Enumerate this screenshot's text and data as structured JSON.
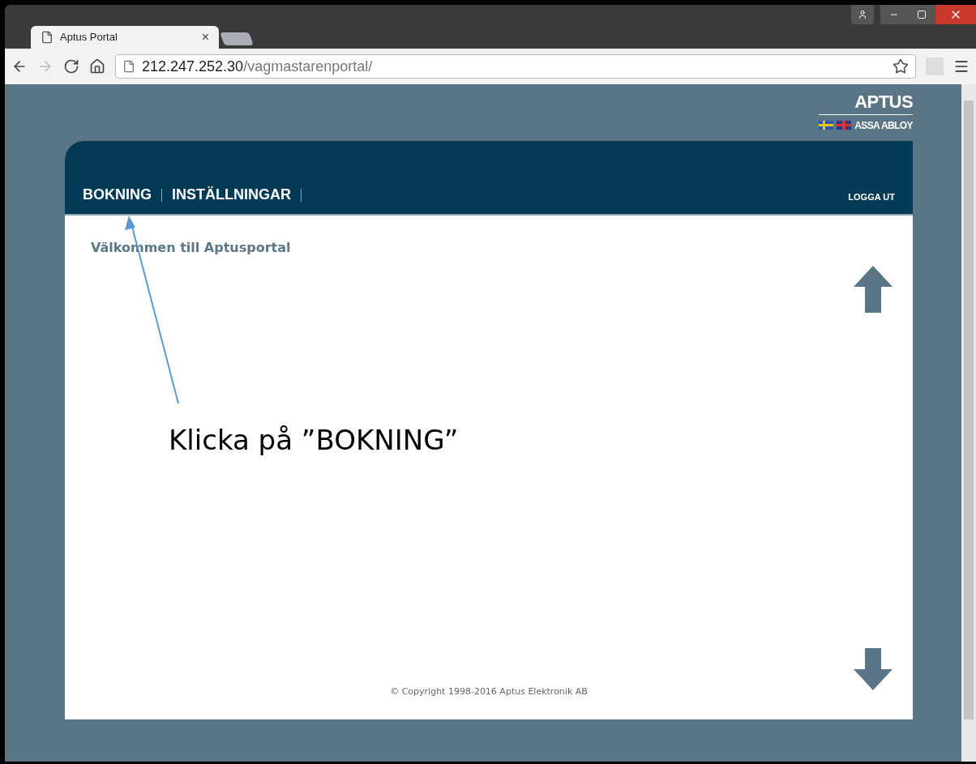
{
  "browser": {
    "tab": {
      "title": "Aptus Portal",
      "close": "×"
    },
    "address": {
      "host": "212.247.252.30",
      "path": "/vagmastarenportal/"
    }
  },
  "logo": {
    "brand": "APTUS",
    "sub": "ASSA ABLOY"
  },
  "nav": {
    "items": [
      {
        "label": "BOKNING"
      },
      {
        "label": "INSTÄLLNINGAR"
      }
    ],
    "logout": "LOGGA UT"
  },
  "welcome": "Välkommen till Aptusportal",
  "copyright": "© Copyright 1998-2016 Aptus Elektronik AB",
  "annotation": "Klicka på ”BOKNING”"
}
